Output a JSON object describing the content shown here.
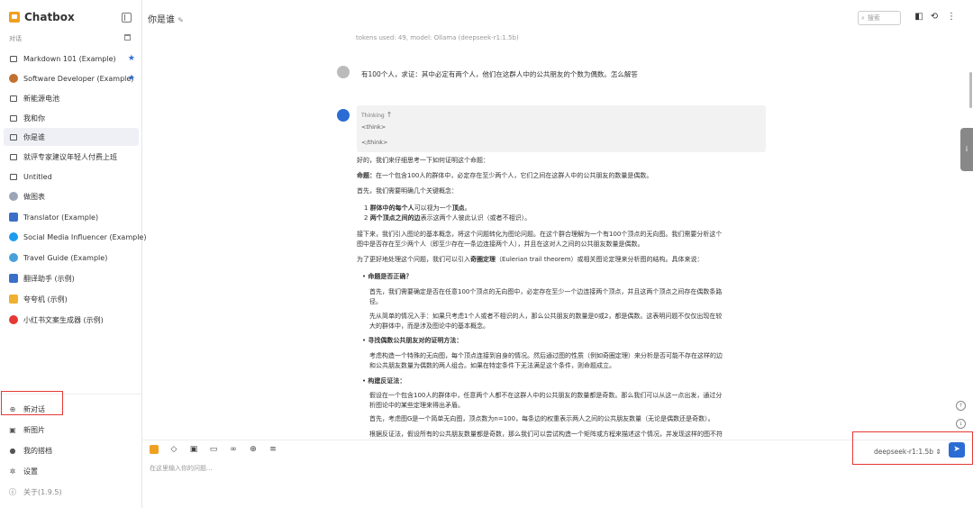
{
  "app": {
    "name": "Chatbox"
  },
  "sidebar": {
    "section_label": "对话",
    "sessions": [
      {
        "label": "Markdown 101 (Example)",
        "icon": "chat-icon",
        "starred": true
      },
      {
        "label": "Software Developer (Example)",
        "icon": "avatar-icon",
        "starred": true
      },
      {
        "label": "新能源电池",
        "icon": "chat-icon",
        "starred": false
      },
      {
        "label": "我和你",
        "icon": "chat-icon",
        "starred": false
      },
      {
        "label": "你是谁",
        "icon": "chat-icon",
        "starred": false,
        "active": true
      },
      {
        "label": "就评专家建议年轻人付费上班",
        "icon": "chat-icon",
        "starred": false
      },
      {
        "label": "Untitled",
        "icon": "chat-icon",
        "starred": false
      },
      {
        "label": "做图表",
        "icon": "avatar-icon",
        "starred": false
      },
      {
        "label": "Translator (Example)",
        "icon": "avatar-icon",
        "starred": false
      },
      {
        "label": "Social Media Influencer (Example)",
        "icon": "twitter-icon",
        "starred": false
      },
      {
        "label": "Travel Guide (Example)",
        "icon": "globe-icon",
        "starred": false
      },
      {
        "label": "翻译助手 (示例)",
        "icon": "avatar-icon",
        "starred": false
      },
      {
        "label": "夸夸机 (示例)",
        "icon": "avatar-icon",
        "starred": false
      },
      {
        "label": "小红书文案生成器 (示例)",
        "icon": "xhs-icon",
        "starred": false
      }
    ],
    "bottom": {
      "new_chat": "新对话",
      "new_image": "新图片",
      "my_partners": "我的搭档",
      "settings": "设置",
      "about": "关于(1.9.5)"
    }
  },
  "header": {
    "title": "你是谁",
    "search_placeholder": "搜索"
  },
  "chat": {
    "tokens_line": "tokens used: 49, model: Ollama (deepseek-r1:1.5b)",
    "question": "有100个人，求证：其中必定有两个人，他们在这群人中的公共朋友的个数为偶数。怎么解答",
    "thinking_label": "Thinking",
    "think_open": "<think>",
    "think_close": "</think>",
    "answer": {
      "p1": "好的，我们来仔细思考一下如何证明这个命题：",
      "p2_bold": "命题：",
      "p2": "在一个包含100人的群体中，必定存在至少两个人，它们之间在这群人中的公共朋友的数量是偶数。",
      "p3": "首先，我们需要明确几个关键概念：",
      "l1_bold": "群体中的每个人",
      "l1_mid": "可以视为一个",
      "l1_bold2": "顶点",
      "l1_end": "。",
      "l2_bold": "两个顶点之间的边",
      "l2": "表示这两个人彼此认识（或者不相识）。",
      "p4": "接下来，我们引入图论的基本概念，将这个问题转化为图论问题。在这个群合理解为一个有100个顶点的无向图。我们需要分析这个",
      "p4b": "图中是否存在至少两个人（即至少存在一条边连接两个人），并且在这对人之间的公共朋友数量是偶数。",
      "p5": "为了更好地处理这个问题，我们可以引入",
      "p5_bold": "奇圈定理",
      "p5_end": "（Eulerian trail theorem）或相关图论定理来分析图的结构。具体来说：",
      "b1_title": "命题是否正确？",
      "b1_p1": "首先，我们需要确定是否在任意100个顶点的无向图中，必定存在至少一个边连接两个顶点，并且这两个顶点之间存在偶数条路",
      "b1_p1b": "径。",
      "b1_p2": "先从简单的情况入手：如果只考虑1个人或者不相识的人，那么公共朋友的数量是0或2，都是偶数。这表明问题不仅仅出现在较",
      "b1_p2b": "大的群体中，而是涉及图论中的基本概念。",
      "b2_title": "寻找偶数公共朋友对的证明方法：",
      "b2_p1": "考虑构造一个特殊的无向图，每个顶点连接到自身的情况。然后通过图的性质（例如奇圈定理）来分析是否可能不存在这样的边",
      "b2_p1b": "和公共朋友数量为偶数的两人组合。如果在特定条件下无法满足这个条件，则命题成立。",
      "b3_title": "构建反证法：",
      "b3_p1": "假设在一个包含100人的群体中，任意两个人都不在这群人中的公共朋友的数量都是奇数。那么我们可以从这一点出发，通过分",
      "b3_p1b": "析图论中的某些定理来得出矛盾。",
      "b3_p2": "首先，考虑图G是一个简单无向图，顶点数为n=100，每条边的权重表示两人之间的公共朋友数量（无论是偶数还是奇数）。",
      "b3_p3": "根据反证法，假设所有的公共朋友数量都是奇数，那么我们可以尝试构造一个矩阵或方程来描述这个情况，并发现这样的图不符"
    }
  },
  "composer": {
    "placeholder": "在这里输入你的问题...",
    "model": "deepseek-r1:1.5b"
  }
}
